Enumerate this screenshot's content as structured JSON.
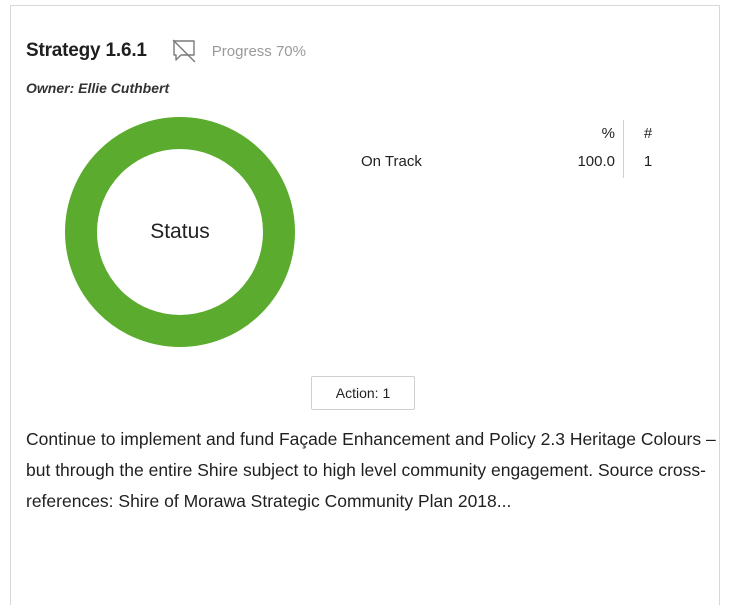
{
  "card": {
    "title": "Strategy 1.6.1",
    "progress_text": "Progress 70%",
    "owner_text": "Owner: Ellie Cuthbert",
    "comment_icon": "comment-disabled-icon",
    "status_chart": {
      "center_label": "Status",
      "color": "#5aab2e",
      "columns": {
        "percent": "%",
        "count": "#"
      },
      "rows": [
        {
          "name": "On Track",
          "percent": "100.0",
          "count": "1"
        }
      ]
    },
    "action_button_label": "Action: 1",
    "description": "Continue to implement and fund Façade Enhancement and Policy 2.3 Heritage Colours – but through the entire Shire subject to high level community engagement. Source cross-references: Shire of Morawa Strategic Community Plan 2018..."
  },
  "chart_data": {
    "type": "pie",
    "title": "Status",
    "categories": [
      "On Track"
    ],
    "values": [
      100.0
    ],
    "counts": [
      1
    ],
    "colors": [
      "#5aab2e"
    ]
  }
}
